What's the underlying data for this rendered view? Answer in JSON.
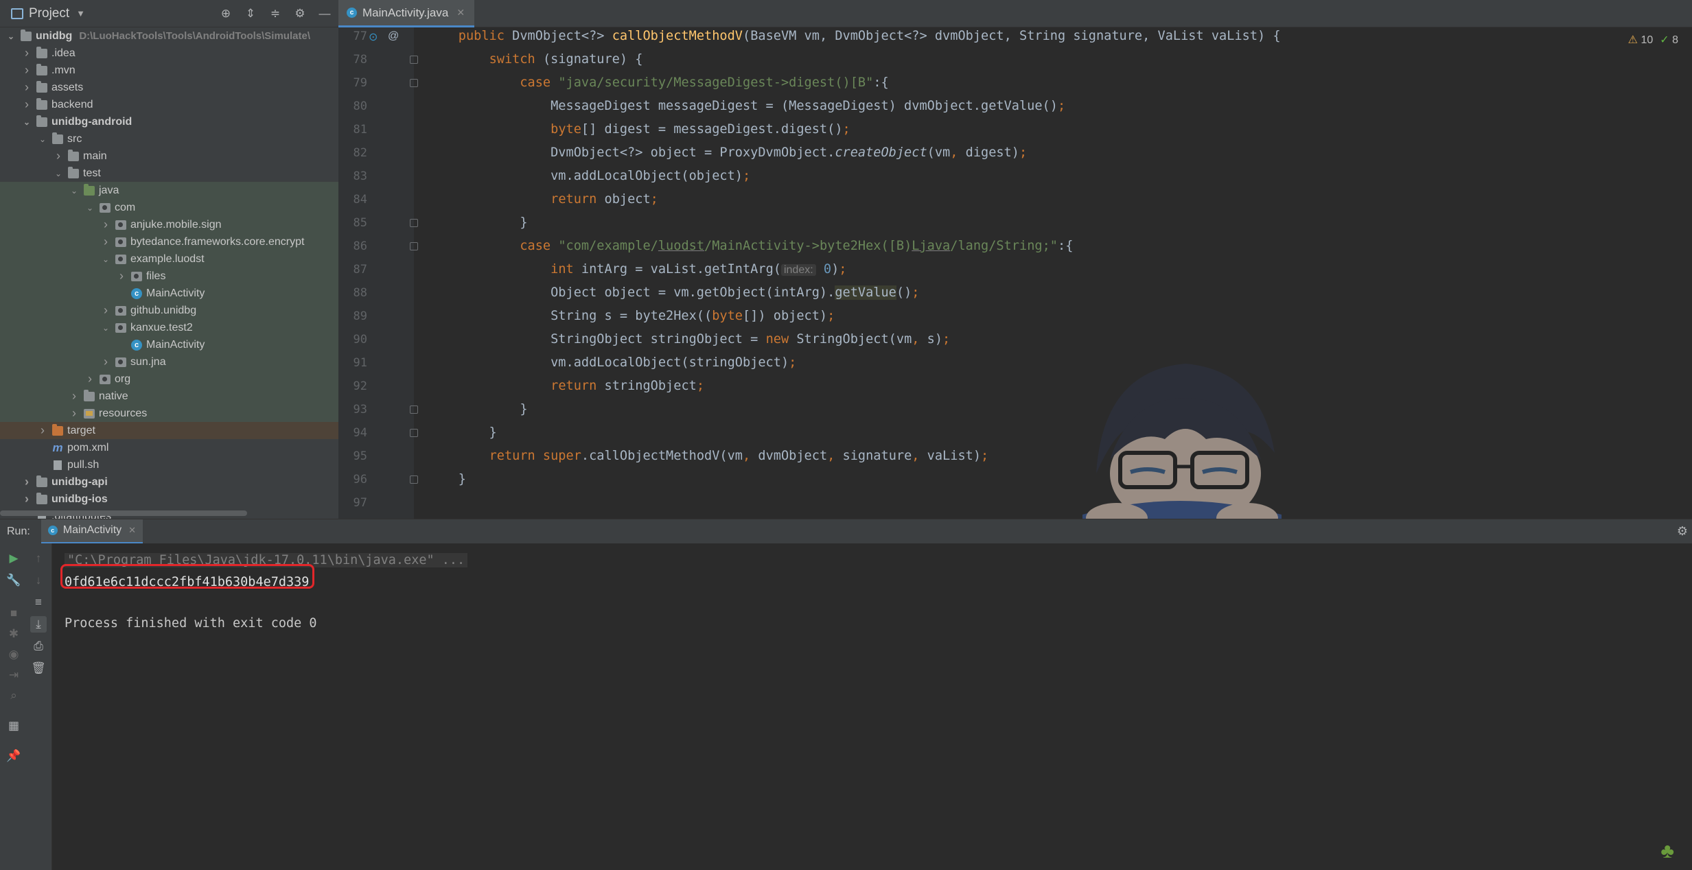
{
  "project": {
    "title": "Project",
    "tree": [
      {
        "label": "unidbg",
        "path": "D:\\LuoHackTools\\Tools\\AndroidTools\\Simulate\\",
        "indent": 0,
        "chev": "v",
        "icon": "folder",
        "bold": true
      },
      {
        "label": ".idea",
        "indent": 1,
        "chev": ">",
        "icon": "folder"
      },
      {
        "label": ".mvn",
        "indent": 1,
        "chev": ">",
        "icon": "folder"
      },
      {
        "label": "assets",
        "indent": 1,
        "chev": ">",
        "icon": "folder"
      },
      {
        "label": "backend",
        "indent": 1,
        "chev": ">",
        "icon": "folder"
      },
      {
        "label": "unidbg-android",
        "indent": 1,
        "chev": "v",
        "icon": "folder",
        "bold": true
      },
      {
        "label": "src",
        "indent": 2,
        "chev": "v",
        "icon": "folder"
      },
      {
        "label": "main",
        "indent": 3,
        "chev": ">",
        "icon": "folder"
      },
      {
        "label": "test",
        "indent": 3,
        "chev": "v",
        "icon": "folder"
      },
      {
        "label": "java",
        "indent": 4,
        "chev": "v",
        "icon": "folder-src",
        "hl": "green"
      },
      {
        "label": "com",
        "indent": 5,
        "chev": "v",
        "icon": "pkg",
        "hl": "green"
      },
      {
        "label": "anjuke.mobile.sign",
        "indent": 6,
        "chev": ">",
        "icon": "pkg",
        "hl": "green"
      },
      {
        "label": "bytedance.frameworks.core.encrypt",
        "indent": 6,
        "chev": ">",
        "icon": "pkg",
        "hl": "green"
      },
      {
        "label": "example.luodst",
        "indent": 6,
        "chev": "v",
        "icon": "pkg",
        "hl": "green"
      },
      {
        "label": "files",
        "indent": 7,
        "chev": ">",
        "icon": "pkg",
        "hl": "green"
      },
      {
        "label": "MainActivity",
        "indent": 7,
        "chev": "",
        "icon": "cls",
        "hl": "green"
      },
      {
        "label": "github.unidbg",
        "indent": 6,
        "chev": ">",
        "icon": "pkg",
        "hl": "green"
      },
      {
        "label": "kanxue.test2",
        "indent": 6,
        "chev": "v",
        "icon": "pkg",
        "hl": "green"
      },
      {
        "label": "MainActivity",
        "indent": 7,
        "chev": "",
        "icon": "cls",
        "hl": "green"
      },
      {
        "label": "sun.jna",
        "indent": 6,
        "chev": ">",
        "icon": "pkg",
        "hl": "green"
      },
      {
        "label": "org",
        "indent": 5,
        "chev": ">",
        "icon": "pkg",
        "hl": "green"
      },
      {
        "label": "native",
        "indent": 4,
        "chev": ">",
        "icon": "folder",
        "hl": "green"
      },
      {
        "label": "resources",
        "indent": 4,
        "chev": ">",
        "icon": "res",
        "hl": "green"
      },
      {
        "label": "target",
        "indent": 2,
        "chev": ">",
        "icon": "folder-orange",
        "hl": "orange"
      },
      {
        "label": "pom.xml",
        "indent": 2,
        "chev": "",
        "icon": "maven"
      },
      {
        "label": "pull.sh",
        "indent": 2,
        "chev": "",
        "icon": "file"
      },
      {
        "label": "unidbg-api",
        "indent": 1,
        "chev": ">",
        "icon": "folder",
        "bold": true
      },
      {
        "label": "unidbg-ios",
        "indent": 1,
        "chev": ">",
        "icon": "folder",
        "bold": true
      },
      {
        "label": ".gitattributes",
        "indent": 1,
        "chev": "",
        "icon": "file"
      }
    ]
  },
  "editor": {
    "tab_label": "MainActivity.java",
    "warnings": "10",
    "checks": "8",
    "line_numbers": [
      "77",
      "78",
      "79",
      "80",
      "81",
      "82",
      "83",
      "84",
      "85",
      "86",
      "87",
      "88",
      "89",
      "90",
      "91",
      "92",
      "93",
      "94",
      "95",
      "96",
      "97"
    ],
    "code": [
      [
        {
          "t": "    "
        },
        {
          "t": "public ",
          "c": "kw"
        },
        {
          "t": "DvmObject<?> "
        },
        {
          "t": "callObjectMethodV",
          "c": "fn"
        },
        {
          "t": "(BaseVM vm, DvmObject<?> dvmObject, String signature, VaList vaList) {"
        }
      ],
      [
        {
          "t": "        "
        },
        {
          "t": "switch ",
          "c": "kw"
        },
        {
          "t": "(signature) {"
        }
      ],
      [
        {
          "t": "            "
        },
        {
          "t": "case ",
          "c": "kw"
        },
        {
          "t": "\"java/security/MessageDigest->digest()[B\"",
          "c": "str"
        },
        {
          "t": ":{"
        }
      ],
      [
        {
          "t": "                MessageDigest messageDigest = (MessageDigest) dvmObject.getValue()"
        },
        {
          "t": ";",
          "c": "kw"
        }
      ],
      [
        {
          "t": "                "
        },
        {
          "t": "byte",
          "c": "kw"
        },
        {
          "t": "[] digest = messageDigest.digest()"
        },
        {
          "t": ";",
          "c": "kw"
        }
      ],
      [
        {
          "t": "                DvmObject<?> object = ProxyDvmObject."
        },
        {
          "t": "createObject",
          "c": "it"
        },
        {
          "t": "(vm"
        },
        {
          "t": ", ",
          "c": "kw"
        },
        {
          "t": "digest)"
        },
        {
          "t": ";",
          "c": "kw"
        }
      ],
      [
        {
          "t": "                vm.addLocalObject(object)"
        },
        {
          "t": ";",
          "c": "kw"
        }
      ],
      [
        {
          "t": "                "
        },
        {
          "t": "return ",
          "c": "kw"
        },
        {
          "t": "object"
        },
        {
          "t": ";",
          "c": "kw"
        }
      ],
      [
        {
          "t": "            }"
        }
      ],
      [
        {
          "t": "            "
        },
        {
          "t": "case ",
          "c": "kw"
        },
        {
          "t": "\"com/example/",
          "c": "str"
        },
        {
          "t": "luodst",
          "c": "str ul"
        },
        {
          "t": "/MainActivity->byte2Hex([B)",
          "c": "str"
        },
        {
          "t": "Ljava",
          "c": "str ul"
        },
        {
          "t": "/lang/String;\"",
          "c": "str"
        },
        {
          "t": ":{"
        }
      ],
      [
        {
          "t": "                "
        },
        {
          "t": "int ",
          "c": "kw"
        },
        {
          "t": "intArg = vaList.getIntArg("
        },
        {
          "t": "index:",
          "c": "hint"
        },
        {
          "t": " "
        },
        {
          "t": "0",
          "c": "num"
        },
        {
          "t": ")"
        },
        {
          "t": ";",
          "c": "kw"
        }
      ],
      [
        {
          "t": "                Object object = vm.getObject(intArg)."
        },
        {
          "t": "getValue",
          "c": "gv"
        },
        {
          "t": "()"
        },
        {
          "t": ";",
          "c": "kw"
        }
      ],
      [
        {
          "t": "                String s = byte2Hex(("
        },
        {
          "t": "byte",
          "c": "kw"
        },
        {
          "t": "[]) object)"
        },
        {
          "t": ";",
          "c": "kw"
        }
      ],
      [
        {
          "t": "                StringObject stringObject = "
        },
        {
          "t": "new ",
          "c": "kw"
        },
        {
          "t": "StringObject(vm"
        },
        {
          "t": ", ",
          "c": "kw"
        },
        {
          "t": "s)"
        },
        {
          "t": ";",
          "c": "kw"
        }
      ],
      [
        {
          "t": "                vm.addLocalObject(stringObject)"
        },
        {
          "t": ";",
          "c": "kw"
        }
      ],
      [
        {
          "t": "                "
        },
        {
          "t": "return ",
          "c": "kw"
        },
        {
          "t": "stringObject"
        },
        {
          "t": ";",
          "c": "kw"
        }
      ],
      [
        {
          "t": "            }"
        }
      ],
      [
        {
          "t": "        }"
        }
      ],
      [
        {
          "t": "        "
        },
        {
          "t": "return super",
          "c": "kw"
        },
        {
          "t": ".callObjectMethodV(vm"
        },
        {
          "t": ", ",
          "c": "kw"
        },
        {
          "t": "dvmObject"
        },
        {
          "t": ", ",
          "c": "kw"
        },
        {
          "t": "signature"
        },
        {
          "t": ", ",
          "c": "kw"
        },
        {
          "t": "vaList)"
        },
        {
          "t": ";",
          "c": "kw"
        }
      ],
      [
        {
          "t": "    }"
        }
      ],
      [
        {
          "t": ""
        }
      ]
    ]
  },
  "run": {
    "label": "Run:",
    "tab_label": "MainActivity",
    "command": "\"C:\\Program Files\\Java\\jdk-17.0.11\\bin\\java.exe\" ...",
    "result": "0fd61e6c11dccc2fbf41b630b4e7d339",
    "exit_message": "Process finished with exit code 0"
  },
  "colors": {
    "accent": "#4a88c7",
    "highlight_box": "#e2262a",
    "keyword": "#cc7832",
    "string": "#6a8759",
    "function": "#ffc66d"
  }
}
